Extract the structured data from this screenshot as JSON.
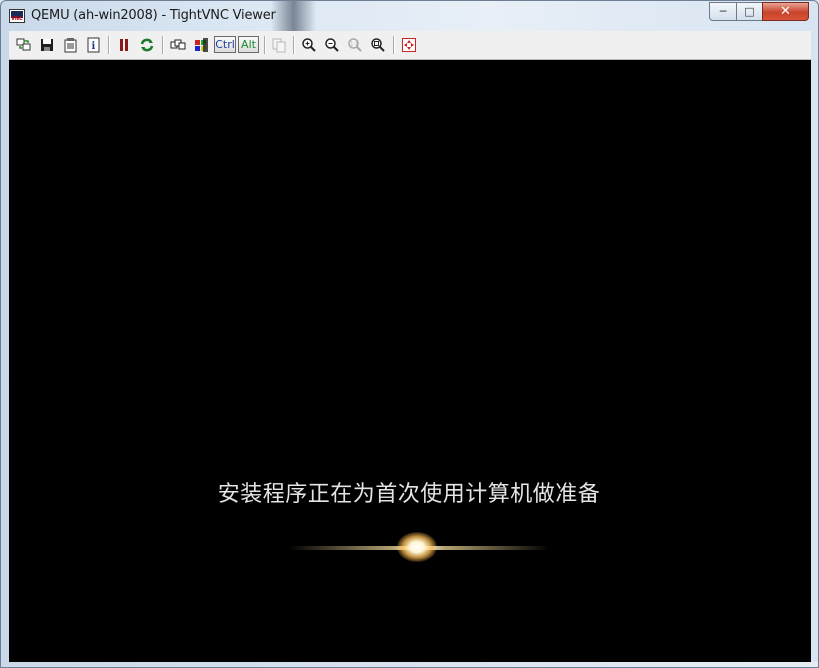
{
  "window": {
    "title": "QEMU (ah-win2008) - TightVNC Viewer",
    "app_icon_text": "VNC",
    "caption_buttons": {
      "minimize": "─",
      "maximize": "□",
      "close": "✕"
    }
  },
  "toolbar": {
    "icons": [
      "new-connection-icon",
      "save-icon",
      "options-icon",
      "connection-info-icon",
      "pause-icon",
      "refresh-icon",
      "ctrl-alt-del-icon",
      "ctrl-esc-icon",
      "transfer-files-icon",
      "zoom-in-icon",
      "zoom-out-icon",
      "zoom-100-icon",
      "zoom-fit-icon",
      "fullscreen-icon"
    ],
    "ctrl_label": "Ctrl",
    "alt_label": "Alt"
  },
  "screen": {
    "message": "安装程序正在为首次使用计算机做准备"
  },
  "colors": {
    "screen_bg": "#000000",
    "message_text": "#e4e4e4",
    "close_button": "#c7432b"
  }
}
